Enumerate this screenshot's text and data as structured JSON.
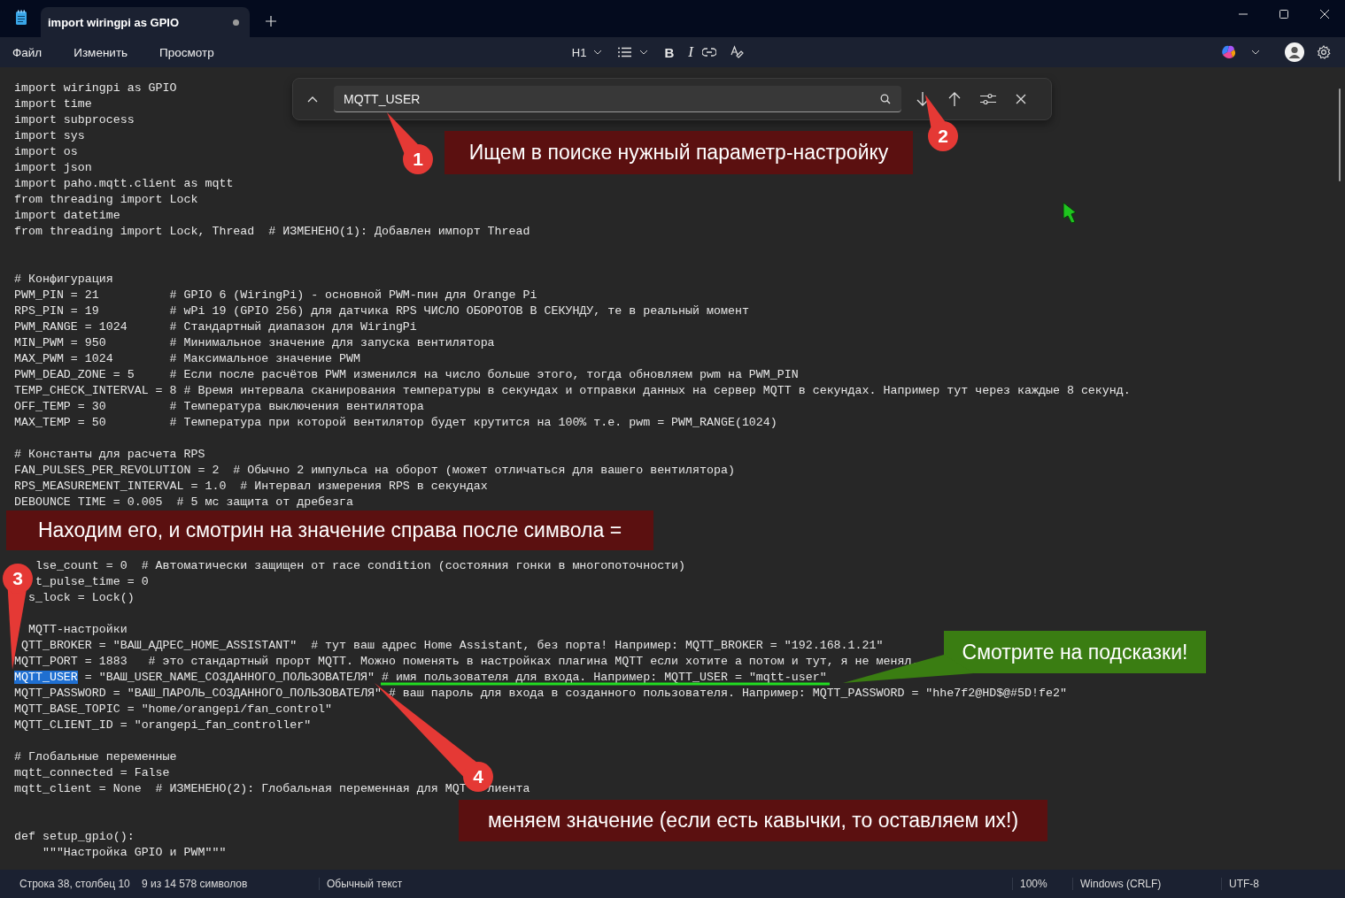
{
  "window": {
    "tab_title": "import wiringpi as GPIO",
    "tab_unsaved": true
  },
  "menu": [
    "Файл",
    "Изменить",
    "Просмотр"
  ],
  "toolbar": {
    "heading": "H1",
    "bold": "B",
    "italic": "I"
  },
  "find": {
    "value": "MQTT_USER"
  },
  "code_lines": [
    {
      "kind": "code",
      "text": "import wiringpi as GPIO"
    },
    {
      "kind": "code",
      "text": "import time"
    },
    {
      "kind": "code",
      "text": "import subprocess"
    },
    {
      "kind": "code",
      "text": "import sys"
    },
    {
      "kind": "code",
      "text": "import os"
    },
    {
      "kind": "code",
      "text": "import json"
    },
    {
      "kind": "code",
      "text": "import paho.mqtt.client as mqtt"
    },
    {
      "kind": "code",
      "text": "from threading import Lock"
    },
    {
      "kind": "code",
      "text": "import datetime"
    },
    {
      "kind": "code",
      "text": "from threading import Lock, Thread  # ИЗМЕНЕНО(1): Добавлен импорт Thread"
    },
    {
      "kind": "blank"
    },
    {
      "kind": "blank"
    },
    {
      "kind": "code",
      "text": "# Конфигурация"
    },
    {
      "kind": "code",
      "text": "PWM_PIN = 21          # GPIO 6 (WiringPi) - основной PWM-пин для Orange Pi"
    },
    {
      "kind": "code",
      "text": "RPS_PIN = 19          # wPi 19 (GPIO 256) для датчика RPS ЧИСЛО ОБОРОТОВ В СЕКУНДУ, те в реальный момент"
    },
    {
      "kind": "code",
      "text": "PWM_RANGE = 1024      # Стандартный диапазон для WiringPi"
    },
    {
      "kind": "code",
      "text": "MIN_PWM = 950         # Минимальное значение для запуска вентилятора"
    },
    {
      "kind": "code",
      "text": "MAX_PWM = 1024        # Максимальное значение PWM"
    },
    {
      "kind": "code",
      "text": "PWM_DEAD_ZONE = 5     # Если после расчётов PWM изменился на число больше этого, тогда обновляем pwm на PWM_PIN"
    },
    {
      "kind": "code",
      "text": "TEMP_CHECK_INTERVAL = 8 # Время интервала сканирования температуры в секундах и отправки данных на сервер MQTT в секундах. Например тут через каждые 8 секунд."
    },
    {
      "kind": "code",
      "text": "OFF_TEMP = 30         # Температура выключения вентилятора"
    },
    {
      "kind": "code",
      "text": "MAX_TEMP = 50         # Температура при которой вентилятор будет крутится на 100% т.е. pwm = PWM_RANGE(1024)"
    },
    {
      "kind": "blank"
    },
    {
      "kind": "code",
      "text": "# Константы для расчета RPS"
    },
    {
      "kind": "code",
      "text": "FAN_PULSES_PER_REVOLUTION = 2  # Обычно 2 импульса на оборот (может отличаться для вашего вентилятора)"
    },
    {
      "kind": "code",
      "text": "RPS_MEASUREMENT_INTERVAL = 1.0  # Интервал измерения RPS в секундах"
    },
    {
      "kind": "code",
      "text": "DEBOUNCE TIME = 0.005  # 5 мс защита от дребезга"
    },
    {
      "kind": "code",
      "text": "   lse_count = 0  # Автоматически защищен от race condition (состояния гонки в многопоточности)"
    },
    {
      "kind": "code",
      "text": "   t_pulse_time = 0"
    },
    {
      "kind": "code",
      "text": "  s_lock = Lock()"
    },
    {
      "kind": "blank"
    },
    {
      "kind": "code",
      "text": "  MQTT-настройки"
    },
    {
      "kind": "code",
      "text": " QTT_BROKER = \"ВАШ_АДРЕС_HOME_ASSISTANT\"  # тут ваш адрес Home Assistant, без порта! Например: MQTT_BROKER = \"192.168.1.21\""
    },
    {
      "kind": "code",
      "text": "MQTT_PORT = 1883   # это стандартный прорт MQTT. Можно поменять в настройках плагина MQTT если хотите а потом и тут, я не менял."
    },
    {
      "kind": "code",
      "highlight": "MQTT_USER",
      "text": " = \"ВАШ_USER_NAME_СОЗДАННОГО_ПОЛЬЗОВАТЕЛЯ\" # имя пользователя для входа. Например: MQTT_USER = \"mqtt-user\""
    },
    {
      "kind": "code",
      "text": "MQTT_PASSWORD = \"ВАШ_ПАРОЛЬ_СОЗДАННОГО_ПОЛЬЗОВАТЕЛЯ\" # ваш пароль для входа в созданного пользователя. Например: MQTT_PASSWORD = \"hhe7f2@HD$@#5D!fe2\""
    },
    {
      "kind": "code",
      "text": "MQTT_BASE_TOPIC = \"home/orangepi/fan_control\""
    },
    {
      "kind": "code",
      "text": "MQTT_CLIENT_ID = \"orangepi_fan_controller\""
    },
    {
      "kind": "blank"
    },
    {
      "kind": "code",
      "text": "# Глобальные переменные"
    },
    {
      "kind": "code",
      "text": "mqtt_connected = False"
    },
    {
      "kind": "code",
      "text": "mqtt_client = None  # ИЗМЕНЕНО(2): Глобальная переменная для MQT   лиента"
    },
    {
      "kind": "blank"
    },
    {
      "kind": "blank"
    },
    {
      "kind": "code",
      "text": "def setup_gpio():"
    },
    {
      "kind": "code",
      "text": "    \"\"\"Настройка GPIO и PWM\"\"\""
    }
  ],
  "callouts": [
    {
      "kind": "banner",
      "text": "Ищем в поиске нужный параметр-настройку"
    },
    {
      "kind": "banner",
      "text": "Находим его, и смотрин на значение справа после символа ="
    },
    {
      "kind": "tip",
      "text": "Смотрите на подсказки!"
    },
    {
      "kind": "banner",
      "text": "меняем значение (если есть кавычки, то оставляем их!)"
    }
  ],
  "markers": [
    {
      "text": "1"
    },
    {
      "text": "2"
    },
    {
      "text": "3"
    },
    {
      "text": "4"
    }
  ],
  "status_bar": [
    "Строка 38, столбец 10",
    "9 из 14 578 символов",
    "Обычный текст",
    "100%",
    "Windows (CRLF)",
    "UTF-8"
  ]
}
